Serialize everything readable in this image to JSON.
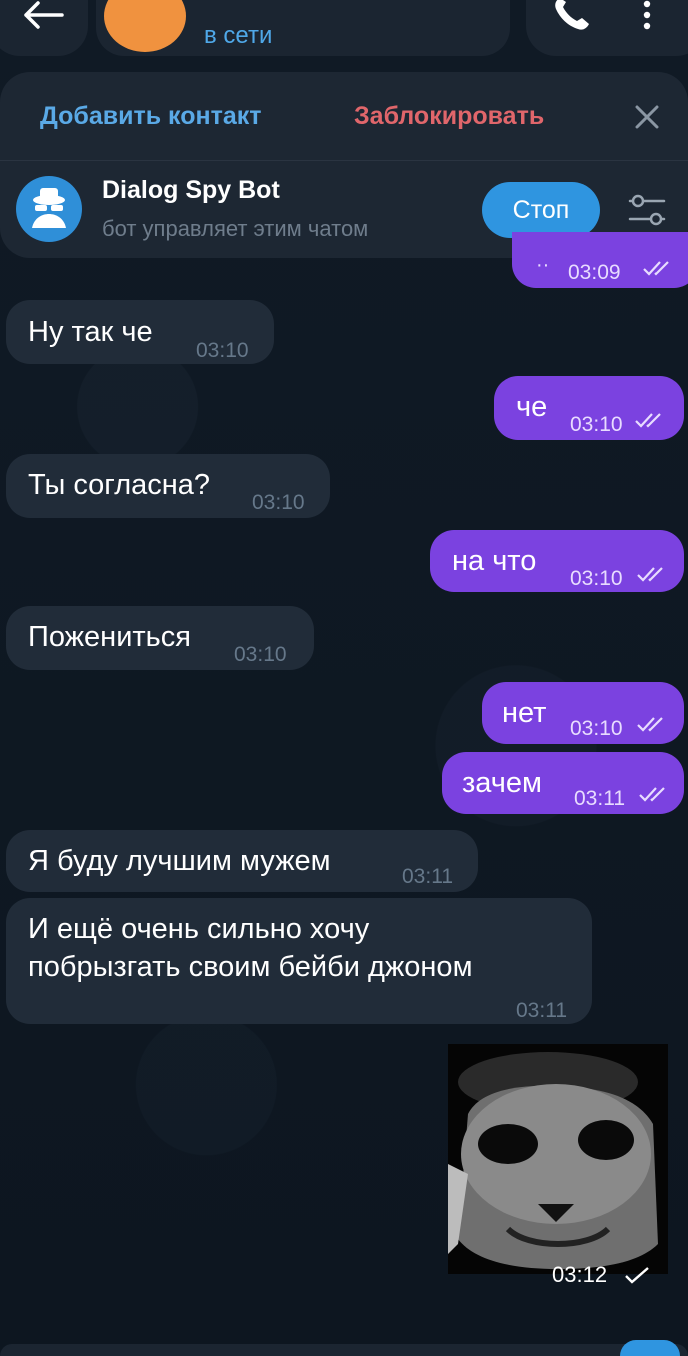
{
  "header": {
    "status": "в сети",
    "icons": [
      "back-arrow-icon",
      "phone-icon",
      "more-vertical-icon"
    ]
  },
  "panel": {
    "add_contact": "Добавить контакт",
    "block": "Заблокировать",
    "bot_name": "Dialog Spy Bot",
    "bot_desc": "бот управляет этим чатом",
    "stop": "Стоп"
  },
  "messages": [
    {
      "dir": "out",
      "text": "··",
      "time": "03:09"
    },
    {
      "dir": "in",
      "text": "Ну так че",
      "time": "03:10"
    },
    {
      "dir": "out",
      "text": "че",
      "time": "03:10"
    },
    {
      "dir": "in",
      "text": "Ты согласна?",
      "time": "03:10"
    },
    {
      "dir": "out",
      "text": "на что",
      "time": "03:10"
    },
    {
      "dir": "in",
      "text": "Пожениться",
      "time": "03:10"
    },
    {
      "dir": "out",
      "text": "нет",
      "time": "03:10"
    },
    {
      "dir": "out",
      "text": "зачем",
      "time": "03:11"
    },
    {
      "dir": "in",
      "text": "Я буду лучшим мужем",
      "time": "03:11"
    },
    {
      "dir": "in",
      "text_line1": "И ещё очень сильно хочу",
      "text_line2": "побрызгать своим бейби джоном",
      "time": "03:11"
    },
    {
      "dir": "out",
      "type": "photo",
      "time": "03:12"
    }
  ],
  "colors": {
    "background": "#0f1823",
    "incoming": "#212c39",
    "outgoing": "#7b42e0",
    "accent": "#2f95e0",
    "danger": "#e0666b"
  }
}
